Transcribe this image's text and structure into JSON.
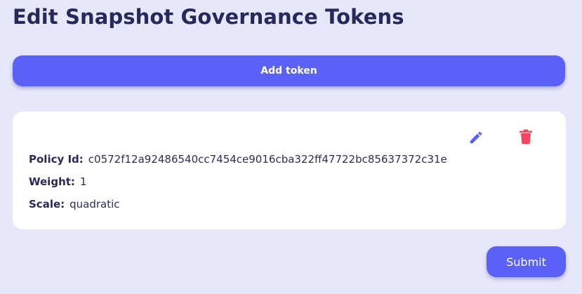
{
  "page": {
    "title": "Edit Snapshot Governance Tokens"
  },
  "toolbar": {
    "add_token_label": "Add token"
  },
  "tokens": [
    {
      "policy_label": "Policy Id:",
      "policy_id": "c0572f12a92486540cc7454ce9016cba322ff47722bc85637372c31e",
      "weight_label": "Weight:",
      "weight": "1",
      "scale_label": "Scale:",
      "scale": "quadratic",
      "edit_icon": "pencil-icon",
      "delete_icon": "trash-icon"
    }
  ],
  "form": {
    "submit_label": "Submit"
  },
  "colors": {
    "background": "#e7e7fc",
    "primary": "#5b60f6",
    "edit_icon": "#5b60f6",
    "delete_icon": "#f2455f",
    "heading": "#26295a"
  }
}
